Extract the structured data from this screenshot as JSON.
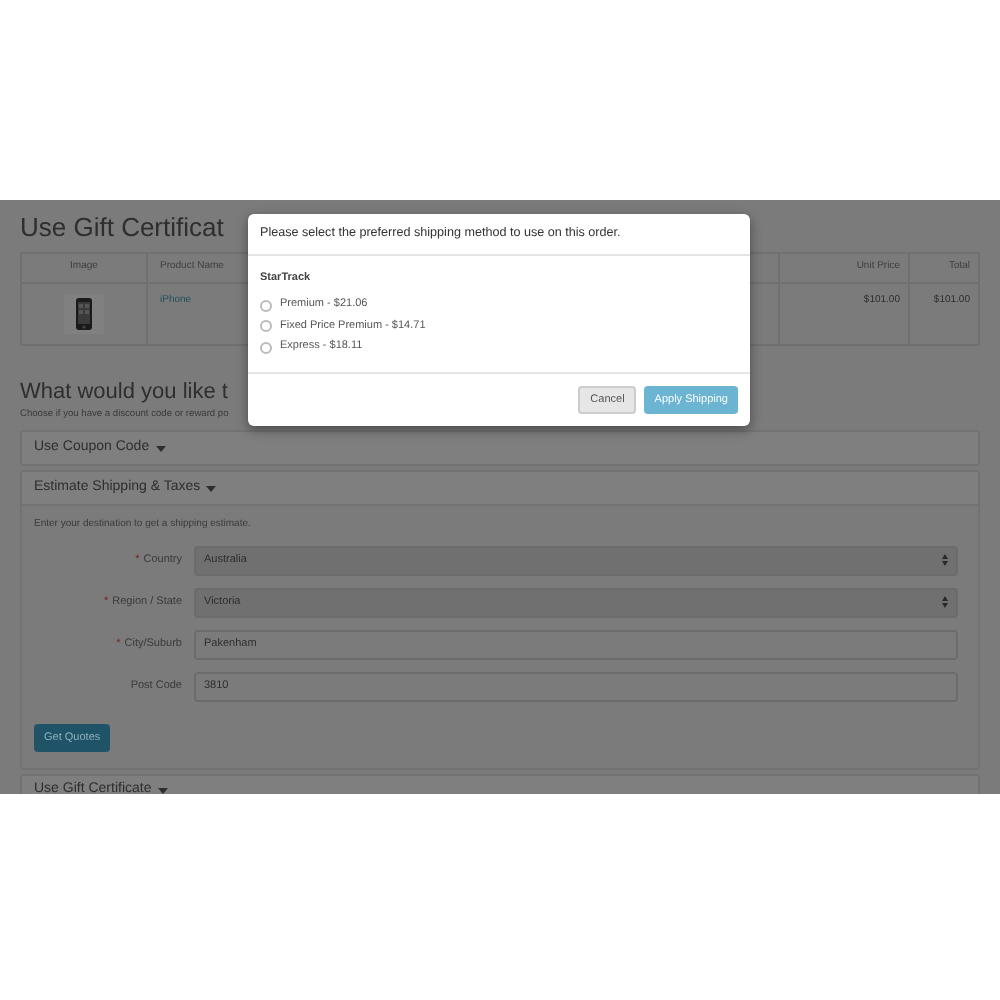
{
  "page": {
    "title": "Use Gift Certificat",
    "table": {
      "columns": [
        "Image",
        "Product Name",
        "Unit Price",
        "Total"
      ],
      "rows": [
        {
          "product": "iPhone",
          "unit_price": "$101.00",
          "total": "$101.00"
        }
      ]
    },
    "section_title": "What would you like t",
    "section_hint": "Choose if you have a discount code or reward po",
    "panels": [
      {
        "title": "Use Coupon Code",
        "expanded": false
      },
      {
        "title": "Estimate Shipping & Taxes",
        "expanded": true,
        "hint": "Enter your destination to get a shipping estimate.",
        "fields": [
          {
            "required_mark": "*",
            "label": "Country",
            "kind": "select",
            "value": "Australia"
          },
          {
            "required_mark": "*",
            "label": "Region / State",
            "kind": "select",
            "value": "Victoria"
          },
          {
            "required_mark": "*",
            "label": "City/Suburb",
            "kind": "text",
            "value": "Pakenham"
          },
          {
            "label": "Post Code",
            "kind": "text",
            "value": "3810"
          }
        ],
        "button": "Get Quotes"
      },
      {
        "title": "Use Gift Certificate",
        "expanded": false
      }
    ]
  },
  "modal": {
    "message": "Please select the preferred shipping method to use on this order.",
    "carrier": "StarTrack",
    "options": [
      {
        "label": "Premium - $21.06",
        "selected": false
      },
      {
        "label": "Fixed Price Premium - $14.71",
        "selected": false
      },
      {
        "label": "Express - $18.11",
        "selected": false
      }
    ],
    "buttons": [
      {
        "label": "Cancel",
        "kind": "secondary"
      },
      {
        "label": "Apply Shipping",
        "kind": "primary"
      }
    ]
  }
}
